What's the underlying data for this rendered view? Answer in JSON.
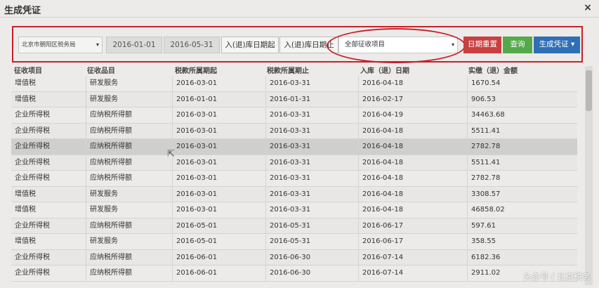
{
  "dialog": {
    "title": "生成凭证",
    "close_glyph": "×"
  },
  "toolbar": {
    "tax_office": "北京市朝阳区税务局",
    "date_start": "2016-01-01",
    "date_end": "2016-05-31",
    "label_in_start": "入(退)库日期起",
    "label_in_end": "入(退)库日期止",
    "tax_item": "全部征收项目",
    "reset_label": "日期重置",
    "query_label": "查询",
    "generate_label": "生成凭证",
    "generate_caret": "▾",
    "select_caret": "▾",
    "colors": {
      "reset": "#c9403f",
      "query": "#55a94b",
      "generate": "#2f6fb5",
      "highlight": "#c8202a"
    }
  },
  "table": {
    "headers": [
      "征收项目",
      "征收品目",
      "税款所属期起",
      "税款所属期止",
      "入库（退）日期",
      "实缴（退）金额"
    ],
    "rows": [
      [
        "增值税",
        "研发服务",
        "2016-03-01",
        "2016-03-31",
        "2016-04-18",
        "1670.54"
      ],
      [
        "增值税",
        "研发服务",
        "2016-01-01",
        "2016-01-31",
        "2016-02-17",
        "906.53"
      ],
      [
        "企业所得税",
        "应纳税所得额",
        "2016-03-01",
        "2016-03-31",
        "2016-04-19",
        "34463.68"
      ],
      [
        "企业所得税",
        "应纳税所得额",
        "2016-03-01",
        "2016-03-31",
        "2016-04-18",
        "5511.41"
      ],
      [
        "企业所得税",
        "应纳税所得额",
        "2016-03-01",
        "2016-03-31",
        "2016-04-18",
        "2782.78"
      ],
      [
        "企业所得税",
        "应纳税所得额",
        "2016-03-01",
        "2016-03-31",
        "2016-04-18",
        "5511.41"
      ],
      [
        "企业所得税",
        "应纳税所得额",
        "2016-03-01",
        "2016-03-31",
        "2016-04-18",
        "2782.78"
      ],
      [
        "增值税",
        "研发服务",
        "2016-03-01",
        "2016-03-31",
        "2016-04-18",
        "3308.57"
      ],
      [
        "增值税",
        "研发服务",
        "2016-03-01",
        "2016-03-31",
        "2016-04-18",
        "46858.02"
      ],
      [
        "企业所得税",
        "应纳税所得额",
        "2016-05-01",
        "2016-05-31",
        "2016-06-17",
        "597.61"
      ],
      [
        "增值税",
        "研发服务",
        "2016-05-01",
        "2016-05-31",
        "2016-06-17",
        "358.55"
      ],
      [
        "企业所得税",
        "应纳税所得额",
        "2016-06-01",
        "2016-06-30",
        "2016-07-14",
        "6182.36"
      ],
      [
        "企业所得税",
        "应纳税所得额",
        "2016-06-01",
        "2016-06-30",
        "2016-07-14",
        "2911.02"
      ]
    ]
  },
  "watermark": "头条号 / 北京税务"
}
